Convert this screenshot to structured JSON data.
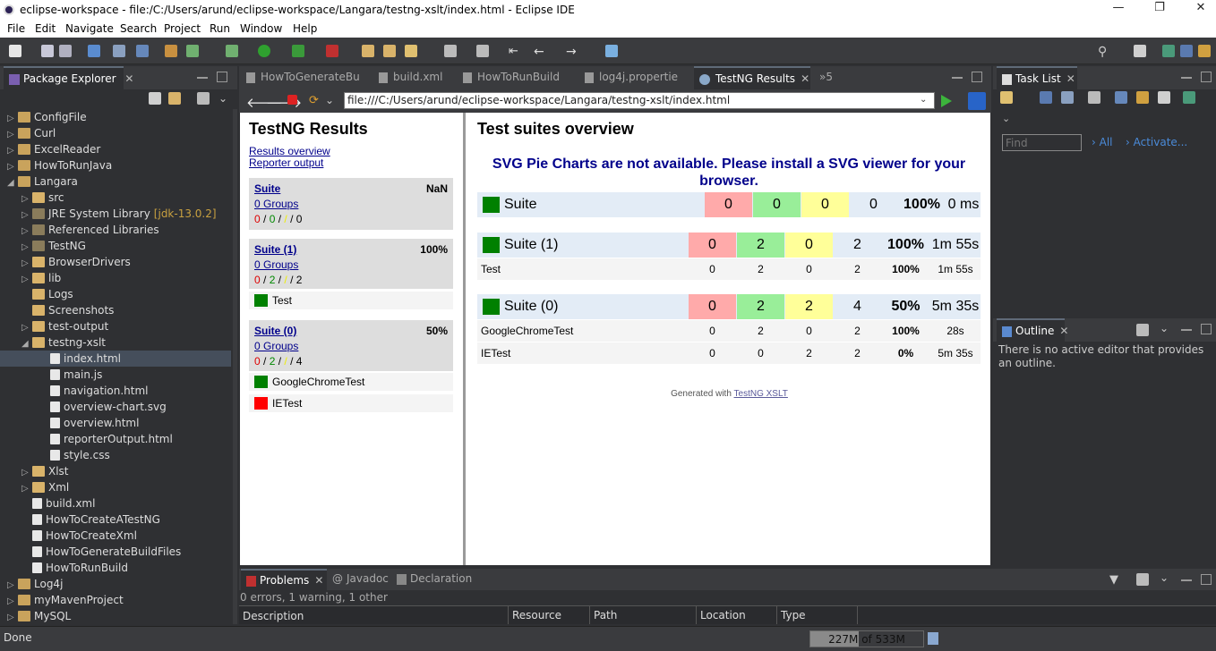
{
  "window": {
    "title": "eclipse-workspace - file:/C:/Users/arund/eclipse-workspace/Langara/testng-xslt/index.html - Eclipse IDE",
    "minimize": "—",
    "restore": "❐",
    "close": "✕"
  },
  "menu": [
    "File",
    "Edit",
    "Navigate",
    "Search",
    "Project",
    "Run",
    "Window",
    "Help"
  ],
  "package_explorer": {
    "title": "Package Explorer",
    "items": [
      {
        "label": "ConfigFile",
        "level": 0,
        "arrow": "▷",
        "type": "proj"
      },
      {
        "label": "Curl",
        "level": 0,
        "arrow": "▷",
        "type": "proj"
      },
      {
        "label": "ExcelReader",
        "level": 0,
        "arrow": "▷",
        "type": "proj"
      },
      {
        "label": "HowToRunJava",
        "level": 0,
        "arrow": "▷",
        "type": "proj"
      },
      {
        "label": "Langara",
        "level": 0,
        "arrow": "◢",
        "type": "proj"
      },
      {
        "label": "src",
        "level": 1,
        "arrow": "▷",
        "type": "folder"
      },
      {
        "label": "JRE System Library",
        "extra": "[jdk-13.0.2]",
        "level": 1,
        "arrow": "▷",
        "type": "lib"
      },
      {
        "label": "Referenced Libraries",
        "level": 1,
        "arrow": "▷",
        "type": "lib"
      },
      {
        "label": "TestNG",
        "level": 1,
        "arrow": "▷",
        "type": "lib"
      },
      {
        "label": "BrowserDrivers",
        "level": 1,
        "arrow": "▷",
        "type": "folder"
      },
      {
        "label": "lib",
        "level": 1,
        "arrow": "▷",
        "type": "folder"
      },
      {
        "label": "Logs",
        "level": 1,
        "arrow": "",
        "type": "folder"
      },
      {
        "label": "Screenshots",
        "level": 1,
        "arrow": "",
        "type": "folder"
      },
      {
        "label": "test-output",
        "level": 1,
        "arrow": "▷",
        "type": "folder"
      },
      {
        "label": "testng-xslt",
        "level": 1,
        "arrow": "◢",
        "type": "folder"
      },
      {
        "label": "index.html",
        "level": 2,
        "arrow": "",
        "type": "file",
        "selected": true
      },
      {
        "label": "main.js",
        "level": 2,
        "arrow": "",
        "type": "file"
      },
      {
        "label": "navigation.html",
        "level": 2,
        "arrow": "",
        "type": "file"
      },
      {
        "label": "overview-chart.svg",
        "level": 2,
        "arrow": "",
        "type": "file"
      },
      {
        "label": "overview.html",
        "level": 2,
        "arrow": "",
        "type": "file"
      },
      {
        "label": "reporterOutput.html",
        "level": 2,
        "arrow": "",
        "type": "file"
      },
      {
        "label": "style.css",
        "level": 2,
        "arrow": "",
        "type": "file"
      },
      {
        "label": "Xlst",
        "level": 1,
        "arrow": "▷",
        "type": "folder"
      },
      {
        "label": "Xml",
        "level": 1,
        "arrow": "▷",
        "type": "folder"
      },
      {
        "label": "build.xml",
        "level": 1,
        "arrow": "",
        "type": "file"
      },
      {
        "label": "HowToCreateATestNG",
        "level": 1,
        "arrow": "",
        "type": "file"
      },
      {
        "label": "HowToCreateXml",
        "level": 1,
        "arrow": "",
        "type": "file"
      },
      {
        "label": "HowToGenerateBuildFiles",
        "level": 1,
        "arrow": "",
        "type": "file"
      },
      {
        "label": "HowToRunBuild",
        "level": 1,
        "arrow": "",
        "type": "file"
      },
      {
        "label": "Log4j",
        "level": 0,
        "arrow": "▷",
        "type": "proj"
      },
      {
        "label": "myMavenProject",
        "level": 0,
        "arrow": "▷",
        "type": "proj"
      },
      {
        "label": "MySQL",
        "level": 0,
        "arrow": "▷",
        "type": "proj"
      }
    ]
  },
  "editor_tabs": [
    "HowToGenerateBu",
    "build.xml",
    "HowToRunBuild",
    "log4j.propertie",
    "TestNG Results",
    "»5"
  ],
  "browser": {
    "url": "file:///C:/Users/arund/eclipse-workspace/Langara/testng-xslt/index.html"
  },
  "testng": {
    "left_title": "TestNG Results",
    "links": [
      "Results overview",
      "Reporter output"
    ],
    "suites": [
      {
        "name": "Suite",
        "percent": "NaN",
        "groups": "0 Groups",
        "fail": "0",
        "pass": "0",
        "skip": "/",
        "total": "0",
        "tests": []
      },
      {
        "name": "Suite (1)",
        "percent": "100%",
        "groups": "0 Groups",
        "fail": "0",
        "pass": "2",
        "skip": "/",
        "total": "2",
        "tests": [
          {
            "name": "Test",
            "status": "pass"
          }
        ]
      },
      {
        "name": "Suite (0)",
        "percent": "50%",
        "groups": "0 Groups",
        "fail": "0",
        "pass": "2",
        "skip": "/",
        "total": "4",
        "tests": [
          {
            "name": "GoogleChromeTest",
            "status": "pass"
          },
          {
            "name": "IETest",
            "status": "fail"
          }
        ]
      }
    ],
    "right_title": "Test suites overview",
    "svg_message": "SVG Pie Charts are not available. Please install a SVG viewer for your browser.",
    "overview": [
      {
        "name": "Suite",
        "fail": "0",
        "pass": "0",
        "skip": "0",
        "total": "0",
        "rate": "100%",
        "time": "0 ms",
        "rows": []
      },
      {
        "name": "Suite (1)",
        "fail": "0",
        "pass": "2",
        "skip": "0",
        "total": "2",
        "rate": "100%",
        "time": "1m 55s",
        "rows": [
          {
            "name": "Test",
            "fail": "0",
            "pass": "2",
            "skip": "0",
            "total": "2",
            "rate": "100%",
            "time": "1m 55s"
          }
        ]
      },
      {
        "name": "Suite (0)",
        "fail": "0",
        "pass": "2",
        "skip": "2",
        "total": "4",
        "rate": "50%",
        "time": "5m 35s",
        "rows": [
          {
            "name": "GoogleChromeTest",
            "fail": "0",
            "pass": "2",
            "skip": "0",
            "total": "2",
            "rate": "100%",
            "time": "28s"
          },
          {
            "name": "IETest",
            "fail": "0",
            "pass": "0",
            "skip": "2",
            "total": "2",
            "rate": "0%",
            "time": "5m 35s"
          }
        ]
      }
    ],
    "generated_prefix": "Generated with",
    "generated_link": "TestNG XSLT"
  },
  "task_list": {
    "title": "Task List",
    "find_placeholder": "Find",
    "all": "All",
    "activate": "Activate..."
  },
  "outline": {
    "title": "Outline",
    "message": "There is no active editor that provides an outline."
  },
  "problems": {
    "tabs": [
      "Problems",
      "Javadoc",
      "Declaration"
    ],
    "summary": "0 errors, 1 warning, 1 other",
    "columns": [
      "Description",
      "Resource",
      "Path",
      "Location",
      "Type"
    ]
  },
  "status": {
    "left": "Done",
    "heap": "227M of 533M",
    "heap_used_fraction": 0.43
  },
  "colors": {
    "pass": "#008000",
    "fail": "#ff0000",
    "skip_bg": "#ffff99",
    "fail_bg": "#ffaaaa",
    "pass_bg": "#99ee99",
    "suite_bg": "#e3ecf6"
  }
}
